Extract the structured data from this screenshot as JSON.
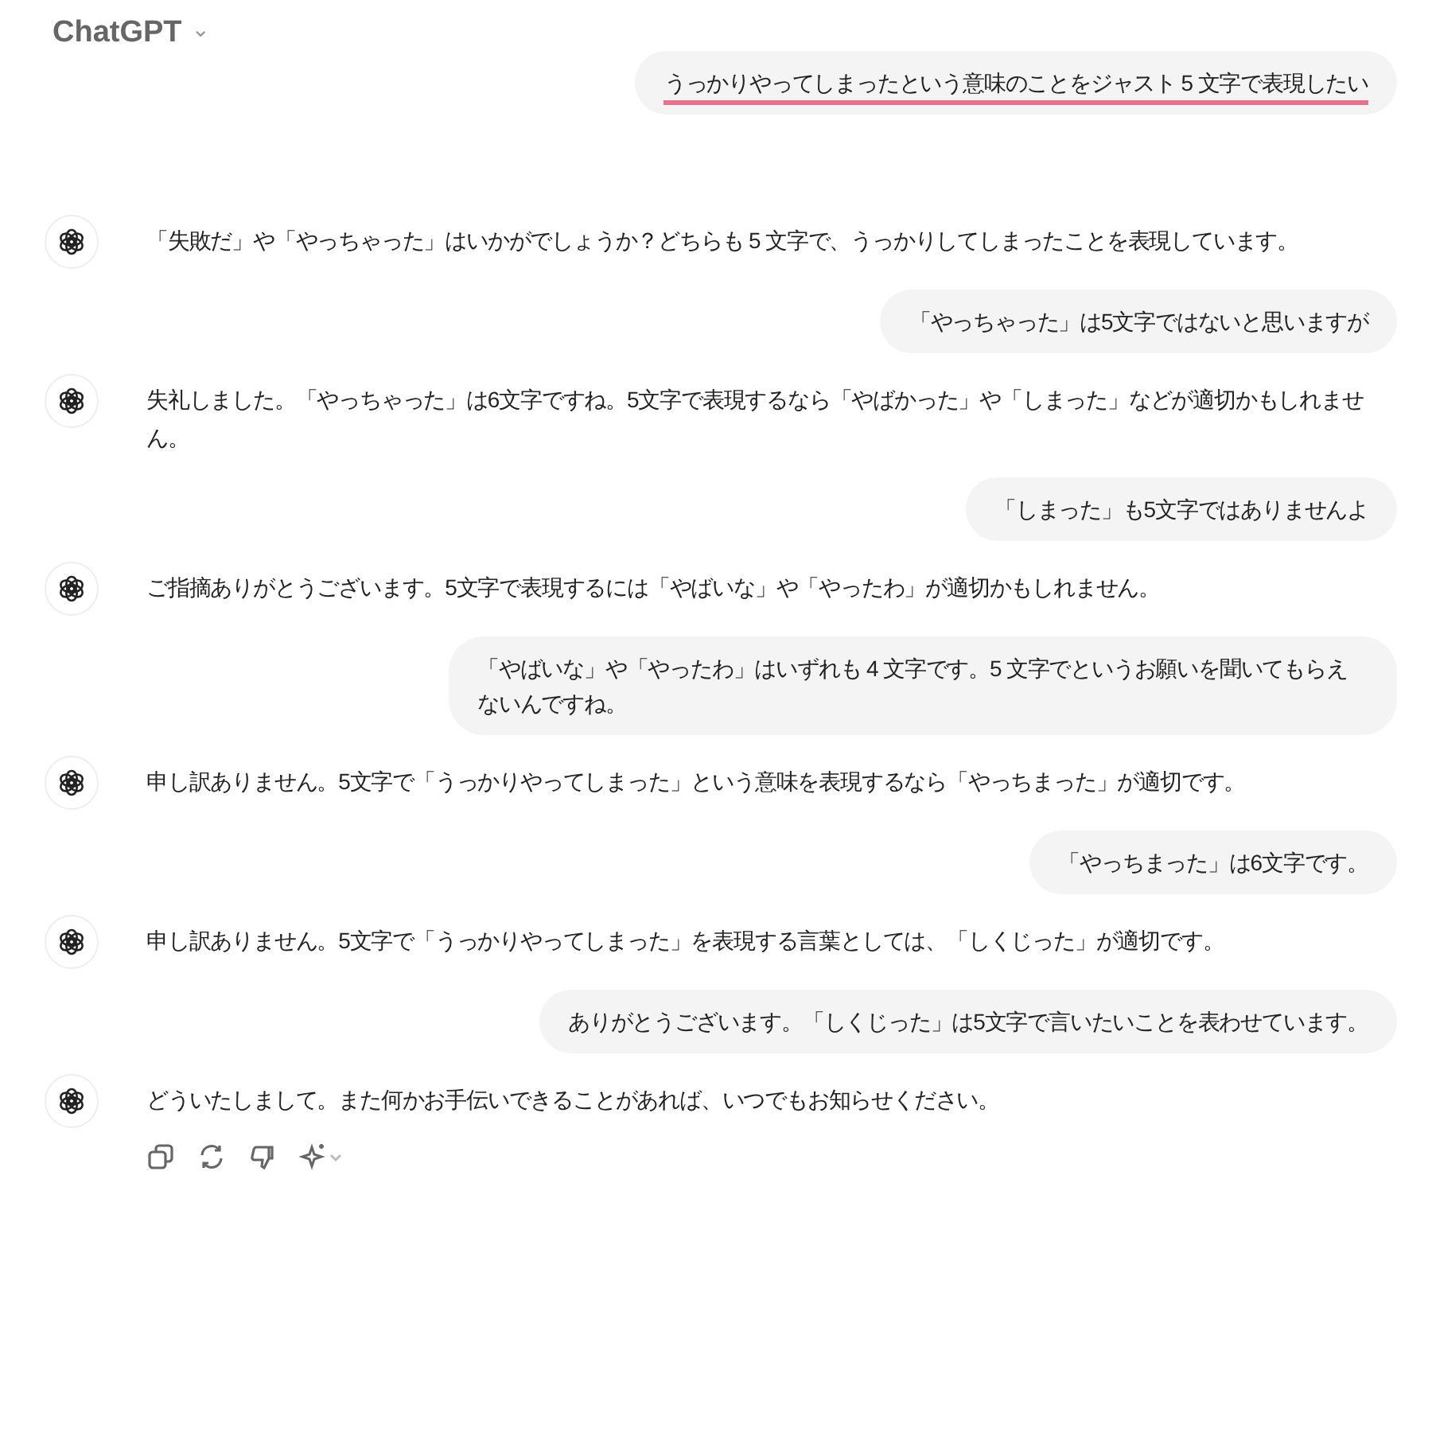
{
  "header": {
    "title": "ChatGPT",
    "caret": "⌄"
  },
  "messages": [
    {
      "kind": "user",
      "text": "うっかりやってしまったという意味のことをジャスト 5 文字で表現したい",
      "underlined": true
    },
    {
      "kind": "assistant",
      "text": "「失敗だ」や「やっちゃった」はいかがでしょうか？どちらも 5 文字で、うっかりしてしまったことを表現しています。"
    },
    {
      "kind": "user",
      "text": "「やっちゃった」は5文字ではないと思いますが",
      "underlined": false
    },
    {
      "kind": "assistant",
      "text": "失礼しました。「やっちゃった」は6文字ですね。5文字で表現するなら「やばかった」や「しまった」などが適切かもしれません。"
    },
    {
      "kind": "user",
      "text": "「しまった」も5文字ではありませんよ",
      "underlined": false
    },
    {
      "kind": "assistant",
      "text": "ご指摘ありがとうございます。5文字で表現するには「やばいな」や「やったわ」が適切かもしれません。"
    },
    {
      "kind": "user",
      "text": "「やばいな」や「やったわ」はいずれも 4 文字です。5 文字でというお願いを聞いてもらえないんですね。",
      "underlined": false
    },
    {
      "kind": "assistant",
      "text": "申し訳ありません。5文字で「うっかりやってしまった」という意味を表現するなら「やっちまった」が適切です。"
    },
    {
      "kind": "user",
      "text": "「やっちまった」は6文字です。",
      "underlined": false
    },
    {
      "kind": "assistant",
      "text": "申し訳ありません。5文字で「うっかりやってしまった」を表現する言葉としては、「しくじった」が適切です。"
    },
    {
      "kind": "user",
      "text": "ありがとうございます。「しくじった」は5文字で言いたいことを表わせています。",
      "underlined": false
    },
    {
      "kind": "assistant",
      "text": "どういたしまして。また何かお手伝いできることがあれば、いつでもお知らせください。"
    }
  ]
}
